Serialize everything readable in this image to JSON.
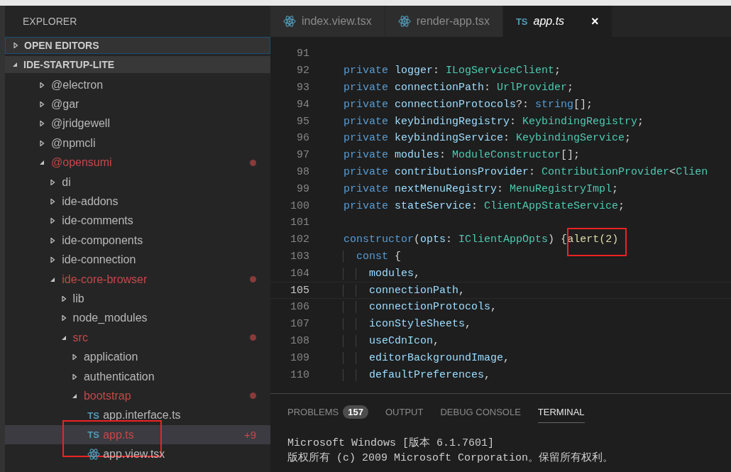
{
  "sidebar": {
    "title": "EXPLORER",
    "sections": [
      {
        "label": "OPEN EDITORS",
        "expanded": false,
        "focused": true
      },
      {
        "label": "IDE-STARTUP-LITE",
        "expanded": true,
        "focused": false
      }
    ],
    "tree": [
      {
        "kind": "folder",
        "name": "@electron",
        "expanded": false,
        "modified": false
      },
      {
        "kind": "folder",
        "name": "@gar",
        "expanded": false,
        "modified": false
      },
      {
        "kind": "folder",
        "name": "@jridgewell",
        "expanded": false,
        "modified": false
      },
      {
        "kind": "folder",
        "name": "@npmcli",
        "expanded": false,
        "modified": false
      },
      {
        "kind": "folder",
        "name": "@opensumi",
        "expanded": true,
        "modified": true,
        "children": [
          {
            "kind": "folder",
            "name": "di",
            "expanded": false,
            "modified": false
          },
          {
            "kind": "folder",
            "name": "ide-addons",
            "expanded": false,
            "modified": false
          },
          {
            "kind": "folder",
            "name": "ide-comments",
            "expanded": false,
            "modified": false
          },
          {
            "kind": "folder",
            "name": "ide-components",
            "expanded": false,
            "modified": false
          },
          {
            "kind": "folder",
            "name": "ide-connection",
            "expanded": false,
            "modified": false
          },
          {
            "kind": "folder",
            "name": "ide-core-browser",
            "expanded": true,
            "modified": true,
            "children": [
              {
                "kind": "folder",
                "name": "lib",
                "expanded": false,
                "modified": false
              },
              {
                "kind": "folder",
                "name": "node_modules",
                "expanded": false,
                "modified": false
              },
              {
                "kind": "folder",
                "name": "src",
                "expanded": true,
                "modified": true,
                "children": [
                  {
                    "kind": "folder",
                    "name": "application",
                    "expanded": false,
                    "modified": false
                  },
                  {
                    "kind": "folder",
                    "name": "authentication",
                    "expanded": false,
                    "modified": false
                  },
                  {
                    "kind": "folder",
                    "name": "bootstrap",
                    "expanded": true,
                    "modified": true,
                    "children": [
                      {
                        "kind": "ts",
                        "icon": "TS",
                        "name": "app.interface.ts",
                        "modified": false,
                        "selected": false,
                        "highlighted": false
                      },
                      {
                        "kind": "ts",
                        "icon": "TS",
                        "name": "app.ts",
                        "modified": true,
                        "badge": "+9",
                        "selected": true,
                        "highlighted": true
                      },
                      {
                        "kind": "tsx",
                        "name": "app.view.tsx",
                        "modified": false,
                        "selected": false,
                        "highlighted": false
                      }
                    ]
                  }
                ]
              }
            ]
          }
        ]
      }
    ]
  },
  "tabs": [
    {
      "kind": "tsx",
      "label": "index.view.tsx",
      "selected": false
    },
    {
      "kind": "tsx",
      "label": "render-app.tsx",
      "selected": false
    },
    {
      "kind": "ts",
      "icon": "TS",
      "label": "app.ts",
      "selected": true,
      "close": "×"
    }
  ],
  "code": [
    {
      "number": "91",
      "current": false
    },
    {
      "number": "92",
      "current": false,
      "tokens": [
        {
          "t": "private",
          "color": "#569cd6"
        },
        {
          "t": " logger",
          "color": "#9cdcfe"
        },
        {
          "t": ": ",
          "color": "#d4d4d4"
        },
        {
          "t": "ILogServiceClient",
          "color": "#4ec9b0"
        },
        {
          "t": ";",
          "color": "#d4d4d4"
        }
      ]
    },
    {
      "number": "93",
      "current": false,
      "tokens": [
        {
          "t": "private",
          "color": "#569cd6"
        },
        {
          "t": " connectionPath",
          "color": "#9cdcfe"
        },
        {
          "t": ": ",
          "color": "#d4d4d4"
        },
        {
          "t": "UrlProvider",
          "color": "#4ec9b0"
        },
        {
          "t": ";",
          "color": "#d4d4d4"
        }
      ]
    },
    {
      "number": "94",
      "current": false,
      "tokens": [
        {
          "t": "private",
          "color": "#569cd6"
        },
        {
          "t": " connectionProtocols",
          "color": "#9cdcfe"
        },
        {
          "t": "?: ",
          "color": "#d4d4d4"
        },
        {
          "t": "string",
          "color": "#569cd6"
        },
        {
          "t": "[];",
          "color": "#d4d4d4"
        }
      ]
    },
    {
      "number": "95",
      "current": false,
      "tokens": [
        {
          "t": "private",
          "color": "#569cd6"
        },
        {
          "t": " keybindingRegistry",
          "color": "#9cdcfe"
        },
        {
          "t": ": ",
          "color": "#d4d4d4"
        },
        {
          "t": "KeybindingRegistry",
          "color": "#4ec9b0"
        },
        {
          "t": ";",
          "color": "#d4d4d4"
        }
      ]
    },
    {
      "number": "96",
      "current": false,
      "tokens": [
        {
          "t": "private",
          "color": "#569cd6"
        },
        {
          "t": " keybindingService",
          "color": "#9cdcfe"
        },
        {
          "t": ": ",
          "color": "#d4d4d4"
        },
        {
          "t": "KeybindingService",
          "color": "#4ec9b0"
        },
        {
          "t": ";",
          "color": "#d4d4d4"
        }
      ]
    },
    {
      "number": "97",
      "current": false,
      "tokens": [
        {
          "t": "private",
          "color": "#569cd6"
        },
        {
          "t": " modules",
          "color": "#9cdcfe"
        },
        {
          "t": ": ",
          "color": "#d4d4d4"
        },
        {
          "t": "ModuleConstructor",
          "color": "#4ec9b0"
        },
        {
          "t": "[];",
          "color": "#d4d4d4"
        }
      ]
    },
    {
      "number": "98",
      "current": false,
      "tokens": [
        {
          "t": "private",
          "color": "#569cd6"
        },
        {
          "t": " contributionsProvider",
          "color": "#9cdcfe"
        },
        {
          "t": ": ",
          "color": "#d4d4d4"
        },
        {
          "t": "ContributionProvider",
          "color": "#4ec9b0"
        },
        {
          "t": "<",
          "color": "#d4d4d4"
        },
        {
          "t": "Clien",
          "color": "#4ec9b0"
        }
      ]
    },
    {
      "number": "99",
      "current": false,
      "tokens": [
        {
          "t": "private",
          "color": "#569cd6"
        },
        {
          "t": " nextMenuRegistry",
          "color": "#9cdcfe"
        },
        {
          "t": ": ",
          "color": "#d4d4d4"
        },
        {
          "t": "MenuRegistryImpl",
          "color": "#4ec9b0"
        },
        {
          "t": ";",
          "color": "#d4d4d4"
        }
      ]
    },
    {
      "number": "100",
      "current": false,
      "tokens": [
        {
          "t": "private",
          "color": "#569cd6"
        },
        {
          "t": " stateService",
          "color": "#9cdcfe"
        },
        {
          "t": ": ",
          "color": "#d4d4d4"
        },
        {
          "t": "ClientAppStateService",
          "color": "#4ec9b0"
        },
        {
          "t": ";",
          "color": "#d4d4d4"
        }
      ]
    },
    {
      "number": "101",
      "current": false
    },
    {
      "number": "102",
      "current": false,
      "tokens": [
        {
          "t": "constructor",
          "color": "#569cd6"
        },
        {
          "t": "(",
          "color": "#d4d4d4"
        },
        {
          "t": "opts",
          "color": "#9cdcfe"
        },
        {
          "t": ": ",
          "color": "#d4d4d4"
        },
        {
          "t": "IClientAppOpts",
          "color": "#4ec9b0"
        },
        {
          "t": ") {",
          "color": "#d4d4d4"
        },
        {
          "t": "alert(2)",
          "color": "#dcdcaa",
          "highlighted": true
        }
      ],
      "children": [
        {
          "number": "103",
          "current": false,
          "tokens": [
            {
              "t": "const",
              "color": "#569cd6"
            },
            {
              "t": " {",
              "color": "#d4d4d4"
            }
          ],
          "children": [
            {
              "number": "104",
              "current": false,
              "tokens": [
                {
                  "t": "modules",
                  "color": "#9cdcfe"
                },
                {
                  "t": ",",
                  "color": "#d4d4d4"
                }
              ]
            },
            {
              "number": "105",
              "current": true,
              "tokens": [
                {
                  "t": "connectionPath",
                  "color": "#9cdcfe"
                },
                {
                  "t": ",",
                  "color": "#d4d4d4"
                }
              ]
            },
            {
              "number": "106",
              "current": false,
              "tokens": [
                {
                  "t": "connectionProtocols",
                  "color": "#9cdcfe"
                },
                {
                  "t": ",",
                  "color": "#d4d4d4"
                }
              ]
            },
            {
              "number": "107",
              "current": false,
              "tokens": [
                {
                  "t": "iconStyleSheets",
                  "color": "#9cdcfe"
                },
                {
                  "t": ",",
                  "color": "#d4d4d4"
                }
              ]
            },
            {
              "number": "108",
              "current": false,
              "tokens": [
                {
                  "t": "useCdnIcon",
                  "color": "#9cdcfe"
                },
                {
                  "t": ",",
                  "color": "#d4d4d4"
                }
              ]
            },
            {
              "number": "109",
              "current": false,
              "tokens": [
                {
                  "t": "editorBackgroundImage",
                  "color": "#9cdcfe"
                },
                {
                  "t": ",",
                  "color": "#d4d4d4"
                }
              ]
            },
            {
              "number": "110",
              "current": false,
              "tokens": [
                {
                  "t": "defaultPreferences",
                  "color": "#9cdcfe"
                },
                {
                  "t": ",",
                  "color": "#d4d4d4"
                }
              ]
            }
          ]
        }
      ]
    }
  ],
  "panel": {
    "tabs": [
      {
        "label": "PROBLEMS",
        "count": "157",
        "selected": false
      },
      {
        "label": "OUTPUT",
        "selected": false
      },
      {
        "label": "DEBUG CONSOLE",
        "selected": false
      },
      {
        "label": "TERMINAL",
        "selected": true
      }
    ],
    "terminal": [
      "Microsoft Windows [版本 6.1.7601]",
      "版权所有 (c) 2009 Microsoft Corporation。保留所有权利。"
    ]
  }
}
